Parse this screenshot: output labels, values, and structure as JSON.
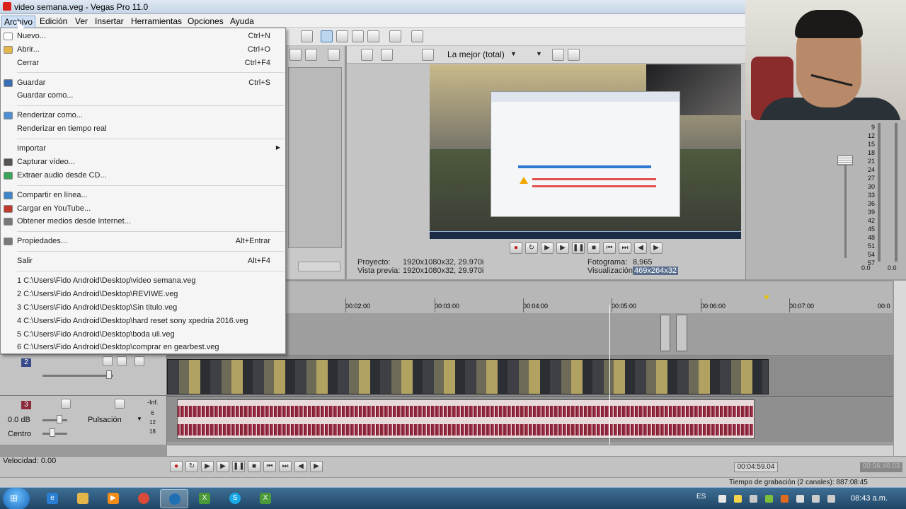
{
  "window": {
    "title": "video semana.veg - Vegas Pro 11.0"
  },
  "menubar": [
    "Archivo",
    "Edición",
    "Ver",
    "Insertar",
    "Herramientas",
    "Opciones",
    "Ayuda"
  ],
  "file_menu": [
    {
      "label": "Nuevo...",
      "shortcut": "Ctrl+N",
      "icon": "new-icon"
    },
    {
      "label": "Abrir...",
      "shortcut": "Ctrl+O",
      "icon": "folder-open-icon"
    },
    {
      "label": "Cerrar",
      "shortcut": "Ctrl+F4",
      "icon": ""
    },
    {
      "separator": true
    },
    {
      "label": "Guardar",
      "shortcut": "Ctrl+S",
      "icon": "save-icon"
    },
    {
      "label": "Guardar como...",
      "shortcut": "",
      "icon": ""
    },
    {
      "separator": true
    },
    {
      "label": "Renderizar como...",
      "shortcut": "",
      "icon": "render-icon"
    },
    {
      "label": "Renderizar en tiempo real",
      "shortcut": "",
      "icon": ""
    },
    {
      "separator": true
    },
    {
      "label": "Importar",
      "shortcut": "",
      "icon": "",
      "submenu": true
    },
    {
      "label": "Capturar vídeo...",
      "shortcut": "",
      "icon": "capture-video-icon"
    },
    {
      "label": "Extraer audio desde CD...",
      "shortcut": "",
      "icon": "cd-icon"
    },
    {
      "separator": true
    },
    {
      "label": "Compartir en línea...",
      "shortcut": "",
      "icon": "share-online-icon"
    },
    {
      "label": "Cargar en YouTube...",
      "shortcut": "",
      "icon": "youtube-icon"
    },
    {
      "label": "Obtener medios desde Internet...",
      "shortcut": "",
      "icon": "internet-media-icon"
    },
    {
      "separator": true
    },
    {
      "label": "Propiedades...",
      "shortcut": "Alt+Entrar",
      "icon": "properties-icon"
    },
    {
      "separator": true
    },
    {
      "label": "Salir",
      "shortcut": "Alt+F4",
      "icon": ""
    },
    {
      "separator": true
    },
    {
      "label": "1 C:\\Users\\Fido Android\\Desktop\\video semana.veg",
      "shortcut": "",
      "icon": ""
    },
    {
      "label": "2 C:\\Users\\Fido Android\\Desktop\\REVIWE.veg",
      "shortcut": "",
      "icon": ""
    },
    {
      "label": "3 C:\\Users\\Fido Android\\Desktop\\Sin titulo.veg",
      "shortcut": "",
      "icon": ""
    },
    {
      "label": "4 C:\\Users\\Fido Android\\Desktop\\hard reset sony xpedria 2016.veg",
      "shortcut": "",
      "icon": ""
    },
    {
      "label": "5 C:\\Users\\Fido Android\\Desktop\\boda uli.veg",
      "shortcut": "",
      "icon": ""
    },
    {
      "label": "6 C:\\Users\\Fido Android\\Desktop\\comprar en gearbest.veg",
      "shortcut": "",
      "icon": ""
    }
  ],
  "preview": {
    "quality": "La mejor (total)",
    "proyecto_label": "Proyecto:",
    "proyecto_val": "1920x1080x32, 29.970i",
    "vista_label": "Vista previa:",
    "vista_val": "1920x1080x32, 29.970i",
    "fotograma_label": "Fotograma:",
    "fotograma_val": "8,965",
    "visual_label": "Visualización:",
    "visual_val": "469x264x32"
  },
  "meter": {
    "scale": [
      "9",
      "12",
      "15",
      "18",
      "21",
      "24",
      "27",
      "30",
      "33",
      "36",
      "39",
      "42",
      "45",
      "48",
      "51",
      "54",
      "57"
    ],
    "left_val": "0.0",
    "right_val": "0.0"
  },
  "ruler": {
    "ticks": [
      "00:02:00",
      "00:03:00",
      "00:04:00",
      "00:05:00",
      "00:06:00",
      "00:07:00",
      "00:0"
    ]
  },
  "tracks": {
    "video_num": "2",
    "audio_num": "3",
    "volume": "0.0 dB",
    "pan": "Centro",
    "fx": "Pulsación",
    "inf": "-Inf.",
    "meter_marks": [
      "6",
      "12",
      "18"
    ]
  },
  "transport_bottom": {
    "speed_label": "Velocidad: 0.00",
    "time": "00:04:59.04",
    "time_disabled": "00:06:46:03"
  },
  "status": {
    "rec_time": "Tiempo de grabación (2 canales): 887:08:45"
  },
  "taskbar": {
    "lang": "ES",
    "clock": "08:43 a.m."
  }
}
